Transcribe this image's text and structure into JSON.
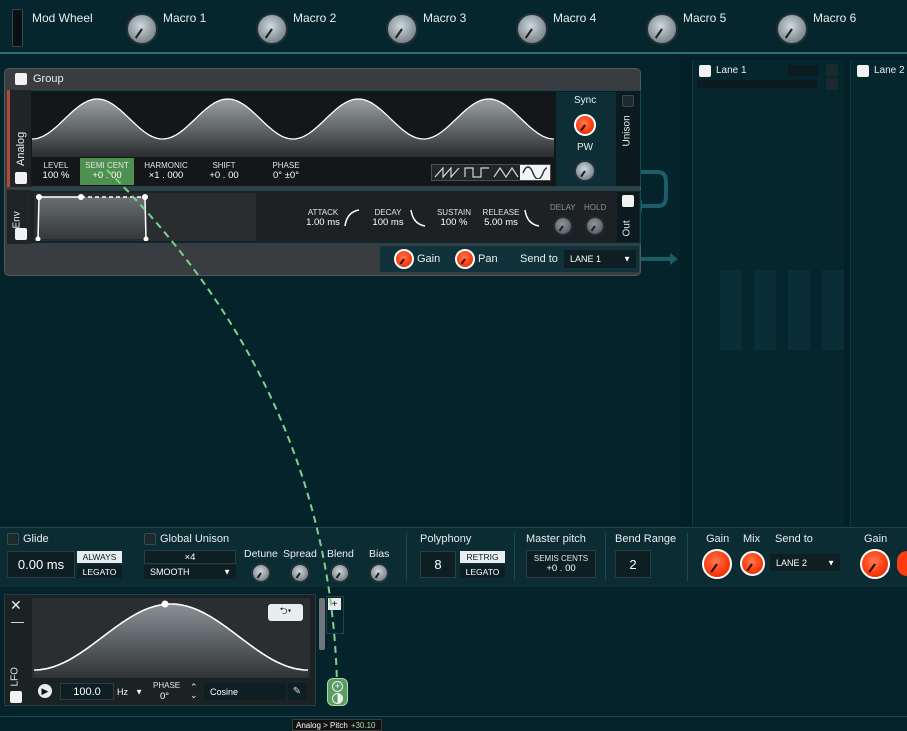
{
  "topbar": {
    "mod_wheel": "Mod Wheel",
    "macros": [
      "Macro 1",
      "Macro 2",
      "Macro 3",
      "Macro 4",
      "Macro 5",
      "Macro 6"
    ]
  },
  "lanes": {
    "lane1": "Lane 1",
    "lane2": "Lane 2"
  },
  "group": {
    "title": "Group",
    "analog": {
      "tab": "Analog",
      "params": [
        {
          "label": "LEVEL",
          "value": "100 %"
        },
        {
          "label": "SEMI CENT",
          "value": "+0 . 00"
        },
        {
          "label": "HARMONIC",
          "value": "×1 . 000"
        },
        {
          "label": "SHIFT",
          "value": "+0 . 00"
        },
        {
          "label": "PHASE",
          "value": "0° ±0°"
        }
      ],
      "sync": "Sync",
      "pw": "PW",
      "unison": "Unison"
    },
    "env": {
      "tab": "Env",
      "params": [
        {
          "label": "ATTACK",
          "value": "1.00 ms"
        },
        {
          "label": "DECAY",
          "value": "100 ms"
        },
        {
          "label": "SUSTAIN",
          "value": "100 %"
        },
        {
          "label": "RELEASE",
          "value": "5.00 ms"
        }
      ],
      "delay": "DELAY",
      "hold": "HOLD",
      "out": "Out"
    },
    "gain": "Gain",
    "pan": "Pan",
    "send_to": "Send to",
    "send_value": "LANE 1"
  },
  "bottom": {
    "glide": "Glide",
    "glide_value": "0.00 ms",
    "always": "ALWAYS",
    "legato": "LEGATO",
    "global_unison": "Global Unison",
    "unison_count": "×4",
    "smooth": "SMOOTH",
    "detune": "Detune",
    "spread": "Spread",
    "blend": "Blend",
    "bias": "Bias",
    "polyphony": "Polyphony",
    "poly_value": "8",
    "retrig": "RETRIG",
    "poly_legato": "LEGATO",
    "master_pitch": "Master pitch",
    "semis_cents": "SEMIS CENTS",
    "pitch_value": "+0 . 00",
    "bend_range": "Bend Range",
    "bend_value": "2",
    "gain": "Gain",
    "mix": "Mix",
    "send_to": "Send to",
    "send_value": "LANE 2",
    "gain2": "Gain"
  },
  "lfo": {
    "tab": "LFO",
    "rate": "100.0",
    "unit": "Hz",
    "phase_label": "PHASE",
    "phase_value": "0°",
    "shape": "Cosine"
  },
  "tooltip": {
    "text": "Analog > Pitch",
    "value": "+30.10"
  },
  "colors": {
    "accent_red": "#ff3d10",
    "mod_green": "#7fd08a",
    "bg": "#05232a"
  }
}
